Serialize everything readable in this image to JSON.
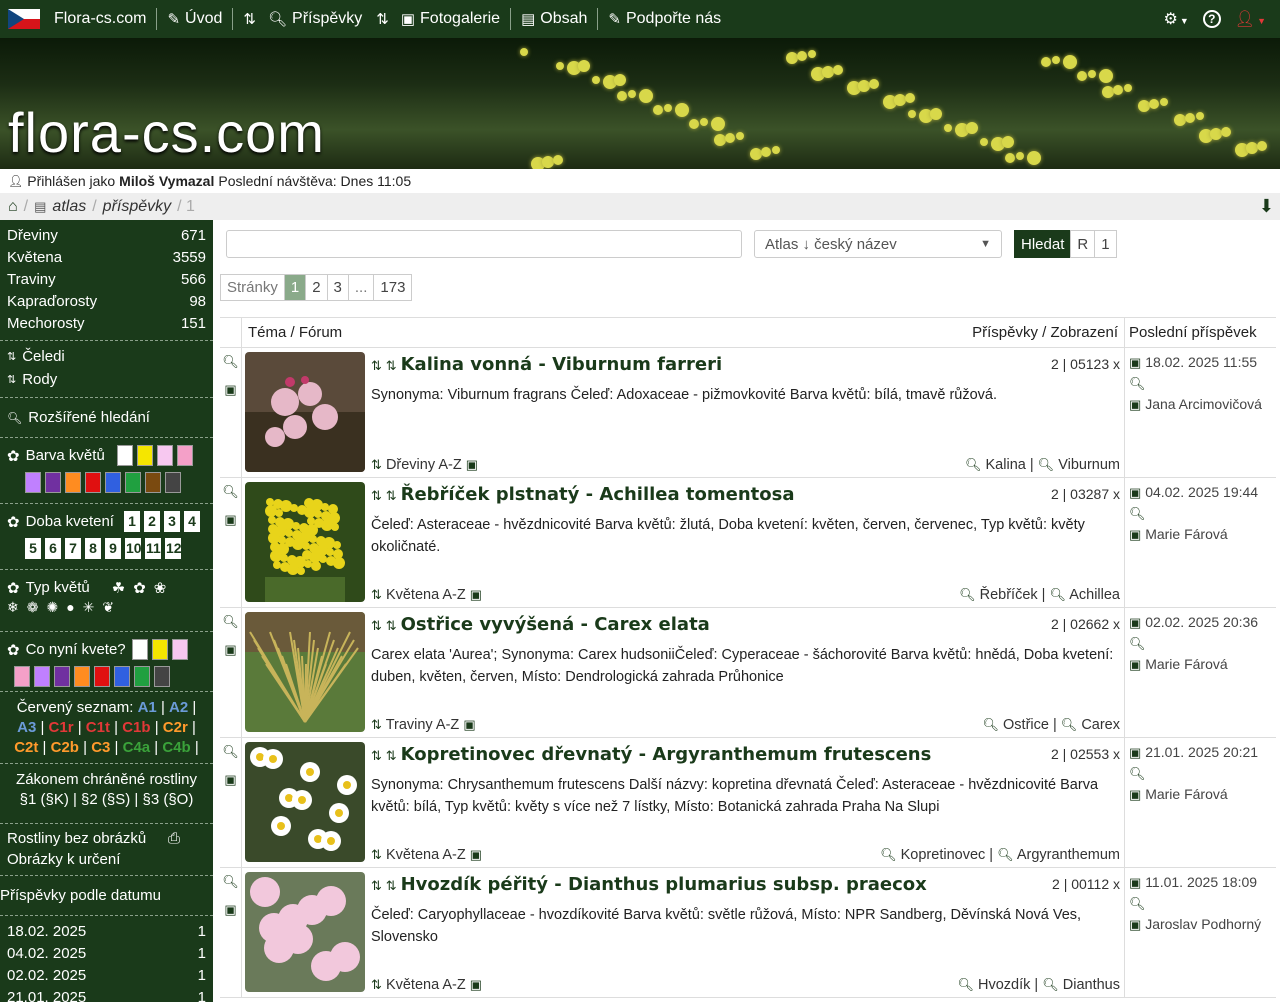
{
  "nav": {
    "site": "Flora-cs.com",
    "uvod": "Úvod",
    "prispevky": "Příspěvky",
    "fotogalerie": "Fotogalerie",
    "obsah": "Obsah",
    "podporte": "Podpořte nás"
  },
  "banner": {
    "logo": "flora-cs.com"
  },
  "login": {
    "prefix": "Přihlášen jako",
    "user": "Miloš Vymazal",
    "last": "Poslední návštěva: Dnes 11:05"
  },
  "crumb": {
    "atlas": "atlas",
    "prispevky": "příspěvky",
    "page": "/ 1"
  },
  "side": {
    "counts": [
      {
        "l": "Dřeviny",
        "n": "671"
      },
      {
        "l": "Květena",
        "n": "3559"
      },
      {
        "l": "Traviny",
        "n": "566"
      },
      {
        "l": "Kapraďorosty",
        "n": "98"
      },
      {
        "l": "Mechorosty",
        "n": "151"
      }
    ],
    "celedi": "Čeledi",
    "rody": "Rody",
    "hledani": "Rozšířené hledání",
    "barva": "Barva květů",
    "doba": "Doba kvetení",
    "typ": "Typ květů",
    "kvete": "Co nyní kvete?",
    "cerveny": "Červený seznam:",
    "chranene1": "Zákonem chráněné rostliny",
    "chranene2": "§1 (§K) | §2 (§S) | §3 (§O)",
    "bez": "Rostliny bez obrázků",
    "urceni": "Obrázky k určení",
    "datum": "Příspěvky podle datumu",
    "dates": [
      {
        "d": "18.02. 2025",
        "n": "1"
      },
      {
        "d": "04.02. 2025",
        "n": "1"
      },
      {
        "d": "02.02. 2025",
        "n": "1"
      },
      {
        "d": "21.01. 2025",
        "n": "1"
      }
    ],
    "colors1": [
      "#ffffff",
      "#f5e600",
      "#f7c8f0",
      "#f4a0c8"
    ],
    "colors2": [
      "#c080ff",
      "#7030a0",
      "#ff8c20",
      "#e01010",
      "#3060e0",
      "#20a040",
      "#7a4a10",
      "#444444"
    ],
    "colors3": [
      "#ffffff",
      "#f5e600",
      "#f7c8f0"
    ],
    "colors4": [
      "#f4a0c8",
      "#c080ff",
      "#7030a0",
      "#ff8c20",
      "#e01010",
      "#3060e0",
      "#20a040",
      "#444444"
    ],
    "months": [
      "1",
      "2",
      "3",
      "4",
      "5",
      "6",
      "7",
      "8",
      "9",
      "10",
      "11",
      "12"
    ]
  },
  "search": {
    "select": "Atlas ↓ český název",
    "hledat": "Hledat",
    "r": "R",
    "one": "1"
  },
  "pages": {
    "label": "Stránky",
    "p1": "1",
    "p2": "2",
    "p3": "3",
    "dots": "...",
    "last": "173"
  },
  "thead": {
    "tema": "Téma / Fórum",
    "prisp": "Příspěvky / Zobrazení",
    "posl": "Poslední příspěvek"
  },
  "posts": [
    {
      "title": "Kalina vonná - Viburnum farreri",
      "stat": "2 | 05123 x",
      "desc": "Synonyma: Viburnum fragrans Čeleď: Adoxaceae - pižmovkovité Barva květů: bílá, tmavě růžová.",
      "cat": "Dřeviny A-Z",
      "g1": "Kalina",
      "g2": "Viburnum",
      "date": "18.02. 2025 11:55",
      "who": "Jana Arcimovičová"
    },
    {
      "title": "Řebříček plstnatý - Achillea tomentosa",
      "stat": "2 | 03287 x",
      "desc": "Čeleď: Asteraceae - hvězdnicovité Barva květů: žlutá, Doba kvetení: květen, červen, červenec, Typ květů: květy okoličnaté.",
      "cat": "Květena A-Z",
      "g1": "Řebříček",
      "g2": "Achillea",
      "date": "04.02. 2025 19:44",
      "who": "Marie Fárová"
    },
    {
      "title": "Ostřice vyvýšená - Carex elata",
      "stat": "2 | 02662 x",
      "desc": "Carex elata 'Aurea'; Synonyma: Carex hudsoniiČeleď: Cyperaceae - šáchorovité Barva květů: hnědá, Doba kvetení: duben, květen, červen, Místo: Dendrologická zahrada Průhonice",
      "cat": "Traviny A-Z",
      "g1": "Ostřice",
      "g2": "Carex",
      "date": "02.02. 2025 20:36",
      "who": "Marie Fárová"
    },
    {
      "title": "Kopretinovec dřevnatý - Argyranthemum frutescens",
      "stat": "2 | 02553 x",
      "desc": "Synonyma: Chrysanthemum frutescens Další názvy: kopretina dřevnatá Čeleď: Asteraceae - hvězdnicovité Barva květů: bílá, Typ květů: květy s více než 7 lístky, Místo: Botanická zahrada Praha Na Slupi",
      "cat": "Květena A-Z",
      "g1": "Kopretinovec",
      "g2": "Argyranthemum",
      "date": "21.01. 2025 20:21",
      "who": "Marie Fárová"
    },
    {
      "title": "Hvozdík péřitý - Dianthus plumarius subsp. praecox",
      "stat": "2 | 00112 x",
      "desc": "Čeleď: Caryophyllaceae - hvozdíkovité Barva květů: světle růžová, Místo: NPR Sandberg, Děvínská Nová Ves, Slovensko",
      "cat": "Květena A-Z",
      "g1": "Hvozdík",
      "g2": "Dianthus",
      "date": "11.01. 2025 18:09",
      "who": "Jaroslav Podhorný"
    }
  ]
}
